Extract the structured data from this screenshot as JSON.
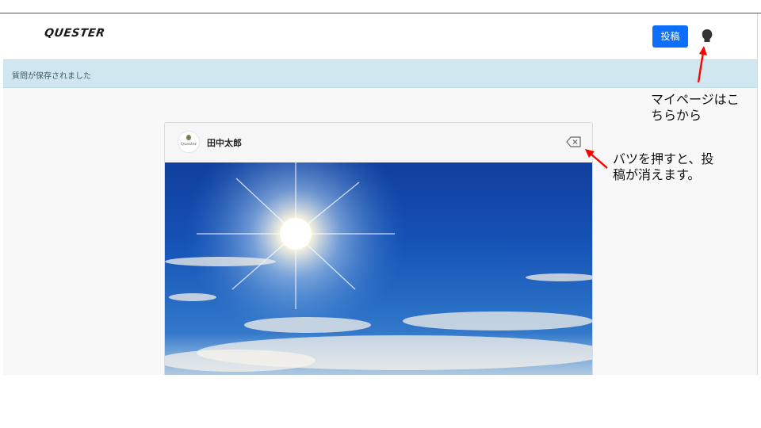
{
  "header": {
    "logo": "QUESTER",
    "post_button_label": "投稿",
    "user_icon": "user-silhouette-icon"
  },
  "alert": {
    "message": "質問が保存されました",
    "color": "#d1e7ef"
  },
  "post_card": {
    "user_name": "田中太郎",
    "avatar_text": "Quester",
    "close_icon": "backspace-close-icon"
  },
  "annotations": {
    "mypage_line1": "マイページはこ",
    "mypage_line2": "ちらから",
    "close_line1": "バツを押すと、投",
    "close_line2": "稿が消えます。",
    "arrow_color": "#ff0000"
  },
  "colors": {
    "accent": "#0d6efd"
  }
}
